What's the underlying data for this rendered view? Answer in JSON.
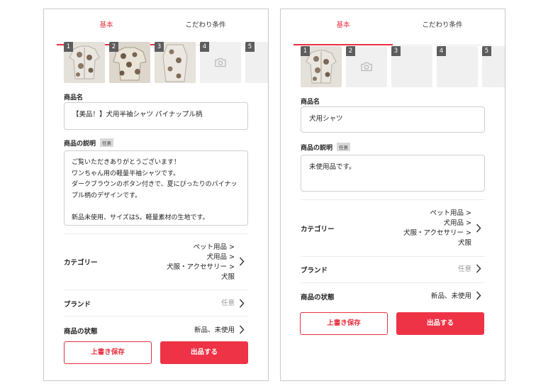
{
  "left": {
    "tabs": [
      "基本",
      "こだわり条件"
    ],
    "photo_numbers": [
      "1",
      "2",
      "3",
      "4",
      "5"
    ],
    "title_label": "商品名",
    "title_value": "【美品！】犬用半袖シャツ パイナップル柄",
    "desc_label": "商品の説明",
    "desc_badge": "任意",
    "desc_value": "ご覧いただきありがとうございます！\nワンちゃん用の軽量半袖シャツです。\nダークブラウンのボタン付きで、夏にぴったりのパイナップル柄のデザインです。\n\n新品未使用、サイズはS。軽量素材の生地です。",
    "category_label": "カテゴリー",
    "category_value": "ペット用品 >\n犬用品 >\n犬服・アクセサリー >\n犬服",
    "brand_label": "ブランド",
    "brand_value": "任意",
    "condition_label": "商品の状態",
    "condition_value": "新品、未使用",
    "save_label": "上書き保存",
    "list_label": "出品する"
  },
  "right": {
    "tabs": [
      "基本",
      "こだわり条件"
    ],
    "photo_numbers": [
      "1",
      "2",
      "3",
      "4",
      "5"
    ],
    "title_label": "商品名",
    "title_value": "犬用シャツ",
    "desc_label": "商品の説明",
    "desc_badge": "任意",
    "desc_value": "未使用品です。",
    "category_label": "カテゴリー",
    "category_value": "ペット用品 >\n犬用品 >\n犬服・アクセサリー >\n犬服",
    "brand_label": "ブランド",
    "brand_value": "任意",
    "condition_label": "商品の状態",
    "condition_value": "新品、未使用",
    "save_label": "上書き保存",
    "list_label": "出品する"
  },
  "colors": {
    "accent": "#e8313f",
    "button_fill": "#ee3346",
    "muted_text": "#9a9a9a"
  },
  "icons": [
    "camera-icon",
    "chevron-right-icon"
  ]
}
